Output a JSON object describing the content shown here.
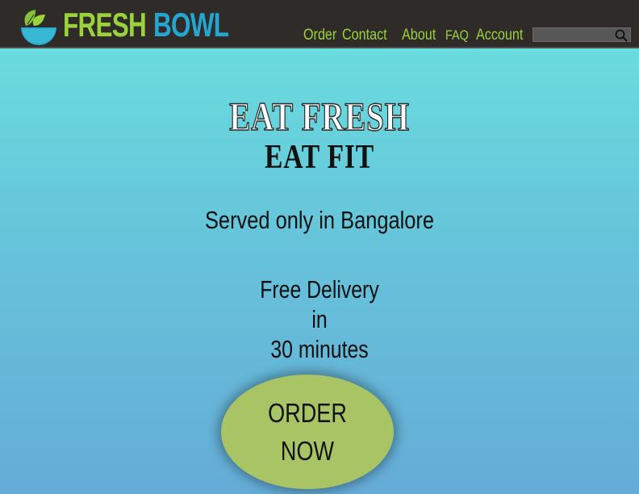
{
  "header": {
    "brand_primary": "FRESH",
    "brand_secondary": "BOWL",
    "logo_icon": "leaf-bowl-icon",
    "nav": {
      "order": "Order",
      "contact": "Contact",
      "about": "About",
      "faq": "FAQ",
      "account": "Account"
    },
    "search": {
      "value": "",
      "icon": "search-icon"
    }
  },
  "hero": {
    "headline_1": "EAT FRESH",
    "headline_2": "EAT FIT",
    "tagline": "Served only in Bangalore",
    "delivery_line_1": "Free Delivery",
    "delivery_line_2": "in",
    "delivery_line_3": "30 minutes",
    "cta_line_1": "ORDER",
    "cta_line_2": "NOW"
  },
  "colors": {
    "topbar": "#2e2b29",
    "brand_green": "#9bd33a",
    "brand_blue": "#26a6cf",
    "gradient_top": "#6ae2de",
    "gradient_bottom": "#65acd8",
    "cta": "#a9c464"
  }
}
